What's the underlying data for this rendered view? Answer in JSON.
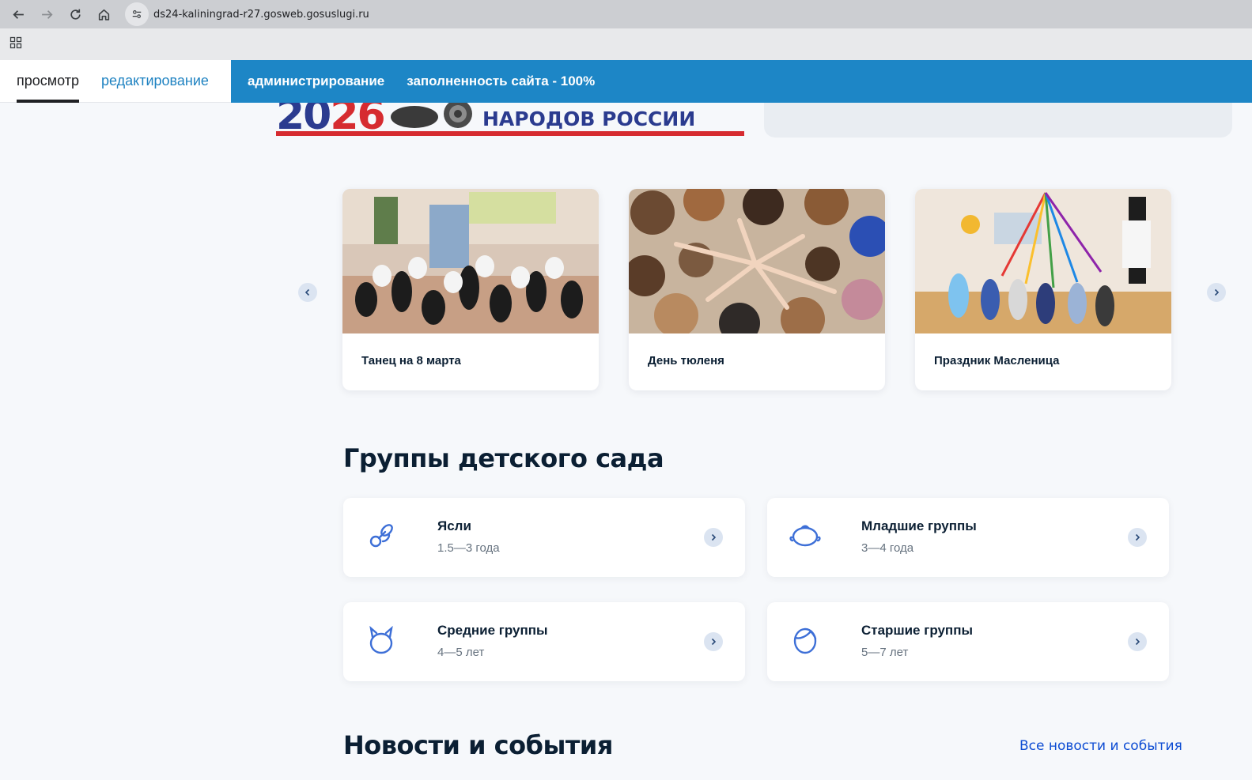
{
  "browser": {
    "url": "ds24-kaliningrad-r27.gosweb.gosuslugi.ru"
  },
  "admin_bar": {
    "view_label": "просмотр",
    "edit_label": "редактирование",
    "admin_label": "администрирование",
    "completeness_label": "заполненность сайта - 100%"
  },
  "banner": {
    "year_part1": "20",
    "year_part2": "26",
    "text": "НАРОДОВ РОССИИ"
  },
  "carousel": {
    "items": [
      {
        "title": "Танец на 8 марта"
      },
      {
        "title": "День тюленя"
      },
      {
        "title": "Праздник Масленица"
      }
    ]
  },
  "groups_section": {
    "heading": "Группы детского сада",
    "groups": [
      {
        "name": "Ясли",
        "age": "1.5—3 года",
        "icon": "pacifier-icon"
      },
      {
        "name": "Младшие группы",
        "age": "3—4 года",
        "icon": "baby-face-icon"
      },
      {
        "name": "Средние группы",
        "age": "4—5 лет",
        "icon": "child-face-icon"
      },
      {
        "name": "Старшие группы",
        "age": "5—7 лет",
        "icon": "kid-face-icon"
      }
    ]
  },
  "news_section": {
    "heading": "Новости и события",
    "all_link": "Все новости и события"
  },
  "colors": {
    "admin_blue": "#1d86c6",
    "link_blue": "#0d4cd3",
    "icon_blue": "#3d6fd7",
    "banner_red": "#d62b30",
    "banner_blue": "#2b3b8f"
  }
}
